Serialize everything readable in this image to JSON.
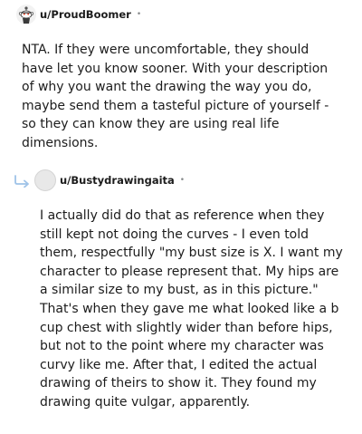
{
  "comments": [
    {
      "username": "u/ProudBoomer",
      "separator": "•",
      "avatar_icon": "snoo-avatar-icon",
      "body": "NTA. If they were uncomfortable, they should have let you know sooner. With your description of why you want the drawing the way you do, maybe send them a tasteful picture of yourself - so they can know they are using real life dimensions."
    },
    {
      "username": "u/Bustydrawingaita",
      "separator": "•",
      "reply_icon": "reply-arrow-icon",
      "avatar_icon": "default-avatar-icon",
      "body": "I actually did do that as reference when they still kept not doing the curves - I even told them, respectfully \"my bust size is X. I want my character to please represent that. My hips are a similar size to my bust, as in this picture.\" That's when they gave me what looked like a b cup chest with slightly wider than before hips, but not to the point where my character was curvy like me. After that, I edited the actual drawing of theirs to show it. They found my drawing quite vulgar, apparently."
    }
  ],
  "colors": {
    "text": "#1c1c1c",
    "meta": "#878a8c",
    "reply_arrow": "#9fc3e8"
  }
}
